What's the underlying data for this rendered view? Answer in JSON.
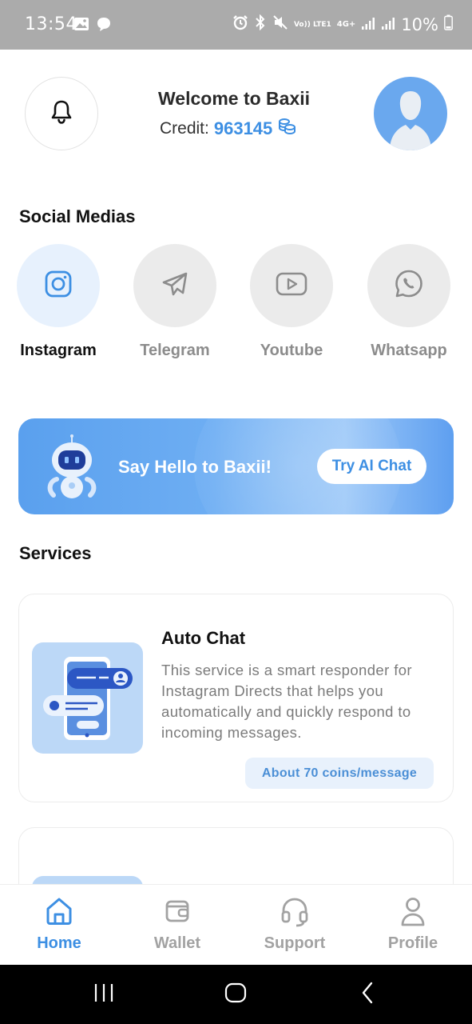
{
  "status_bar": {
    "time": "13:54",
    "left_icons": [
      "image-icon",
      "chat-bubble-icon"
    ],
    "right_icons": [
      "alarm-icon",
      "bluetooth-icon",
      "mute-icon",
      "volte-icon",
      "4g-icon",
      "signal-icon",
      "signal-icon"
    ],
    "volte_label": "Vo)) LTE1",
    "net_label": "4G+",
    "battery": "10%"
  },
  "header": {
    "welcome": "Welcome to Baxii",
    "credit_label": "Credit:",
    "credit_value": "963145"
  },
  "social_medias": {
    "title": "Social Medias",
    "items": [
      {
        "label": "Instagram",
        "icon": "instagram-icon",
        "active": true
      },
      {
        "label": "Telegram",
        "icon": "telegram-icon",
        "active": false
      },
      {
        "label": "Youtube",
        "icon": "youtube-icon",
        "active": false
      },
      {
        "label": "Whatsapp",
        "icon": "whatsapp-icon",
        "active": false
      }
    ]
  },
  "banner": {
    "text": "Say Hello to Baxii!",
    "button_label": "Try AI Chat"
  },
  "services": {
    "title": "Services",
    "cards": [
      {
        "title": "Auto Chat",
        "description": "This service is a smart responder for Instagram Directs that helps you automatically and quickly respond to incoming messages.",
        "badge": "About 70 coins/message"
      }
    ]
  },
  "bottom_nav": {
    "items": [
      {
        "label": "Home",
        "icon": "home-icon",
        "active": true
      },
      {
        "label": "Wallet",
        "icon": "wallet-icon",
        "active": false
      },
      {
        "label": "Support",
        "icon": "headset-icon",
        "active": false
      },
      {
        "label": "Profile",
        "icon": "person-icon",
        "active": false
      }
    ]
  },
  "colors": {
    "accent": "#3d8fe3",
    "status_bar": "#ababab",
    "muted_text": "#8c8c8c",
    "banner": "#5aa0ee"
  }
}
